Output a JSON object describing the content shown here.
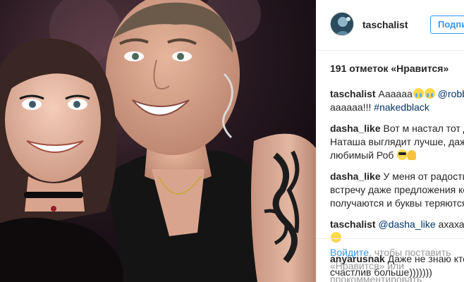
{
  "post": {
    "photo_description_icon": "selfie-photo",
    "author": {
      "username": "taschalist",
      "avatar_icon": "avatar-icon"
    },
    "follow_label": "Подписаться",
    "likes_text": "191 отметок «Нравится»"
  },
  "comments": [
    {
      "user": "taschalist",
      "text_1": "Аааааа",
      "emoji_1": "crying-emoji",
      "mention": "@robbiewilliams",
      "text_2": "аааааа!!!",
      "hashtag": "#nakedblack"
    },
    {
      "user": "dasha_like",
      "line_1": "Вот м настал тот день",
      "line_2": "Наташа выглядит лучше, даже",
      "line_3": "любимый Роб",
      "emoji_1": "sunglasses-emoji",
      "emoji_2": "ok-hand-emoji"
    },
    {
      "user": "dasha_like",
      "line_1": "У меня от радости з",
      "line_2": "встречу даже предложения ко",
      "line_3": "получаются и буквы теряются"
    },
    {
      "user": "taschalist",
      "mention": "@dasha_like",
      "text": "ахахах)))",
      "emoji_1": "smile-emoji"
    },
    {
      "user": "anyarusnak",
      "line_1": "Даже не знаю кто",
      "line_2": "счастлив больше)))))))"
    }
  ],
  "login_prompt": {
    "link": "Войдите",
    "line_1": ", чтобы поставить",
    "line_2": "«Нравится» или",
    "line_3": "прокомментировать."
  }
}
